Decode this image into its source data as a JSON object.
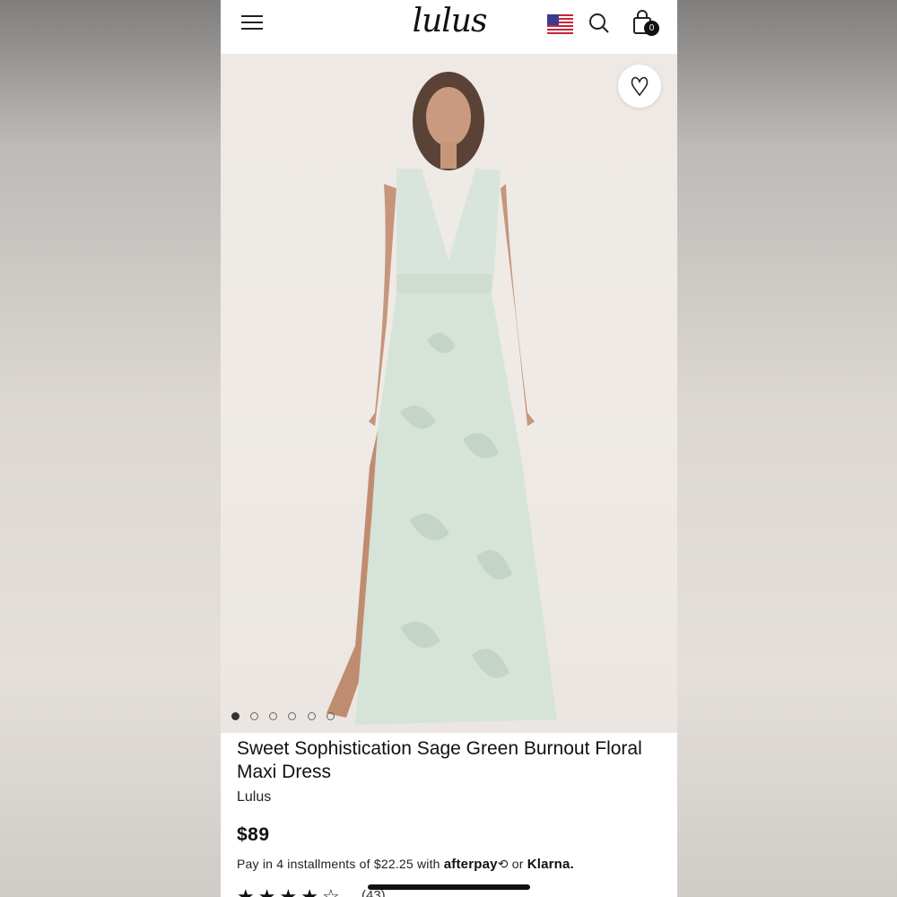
{
  "header": {
    "logo_text": "lulus",
    "cart_count": "0",
    "icons": [
      "hamburger-menu-icon",
      "us-flag-icon",
      "search-icon",
      "shopping-bag-icon"
    ]
  },
  "gallery": {
    "image_alt": "model wearing sage green floral maxi dress",
    "dot_count": 6,
    "active_index": 0,
    "wishlist_icon": "heart-icon"
  },
  "product": {
    "title": "Sweet Sophistication Sage Green Burnout Floral Maxi Dress",
    "brand": "Lulus",
    "price": "$89",
    "installment_prefix": "Pay in 4 installments of $22.25 with",
    "afterpay": "afterpay",
    "or": "or",
    "klarna": "Klarna.",
    "rating": 4,
    "reviews": "(43)"
  },
  "colors": {
    "dress": "#d6e3d9",
    "background": "#eee9e5",
    "text": "#111111"
  }
}
